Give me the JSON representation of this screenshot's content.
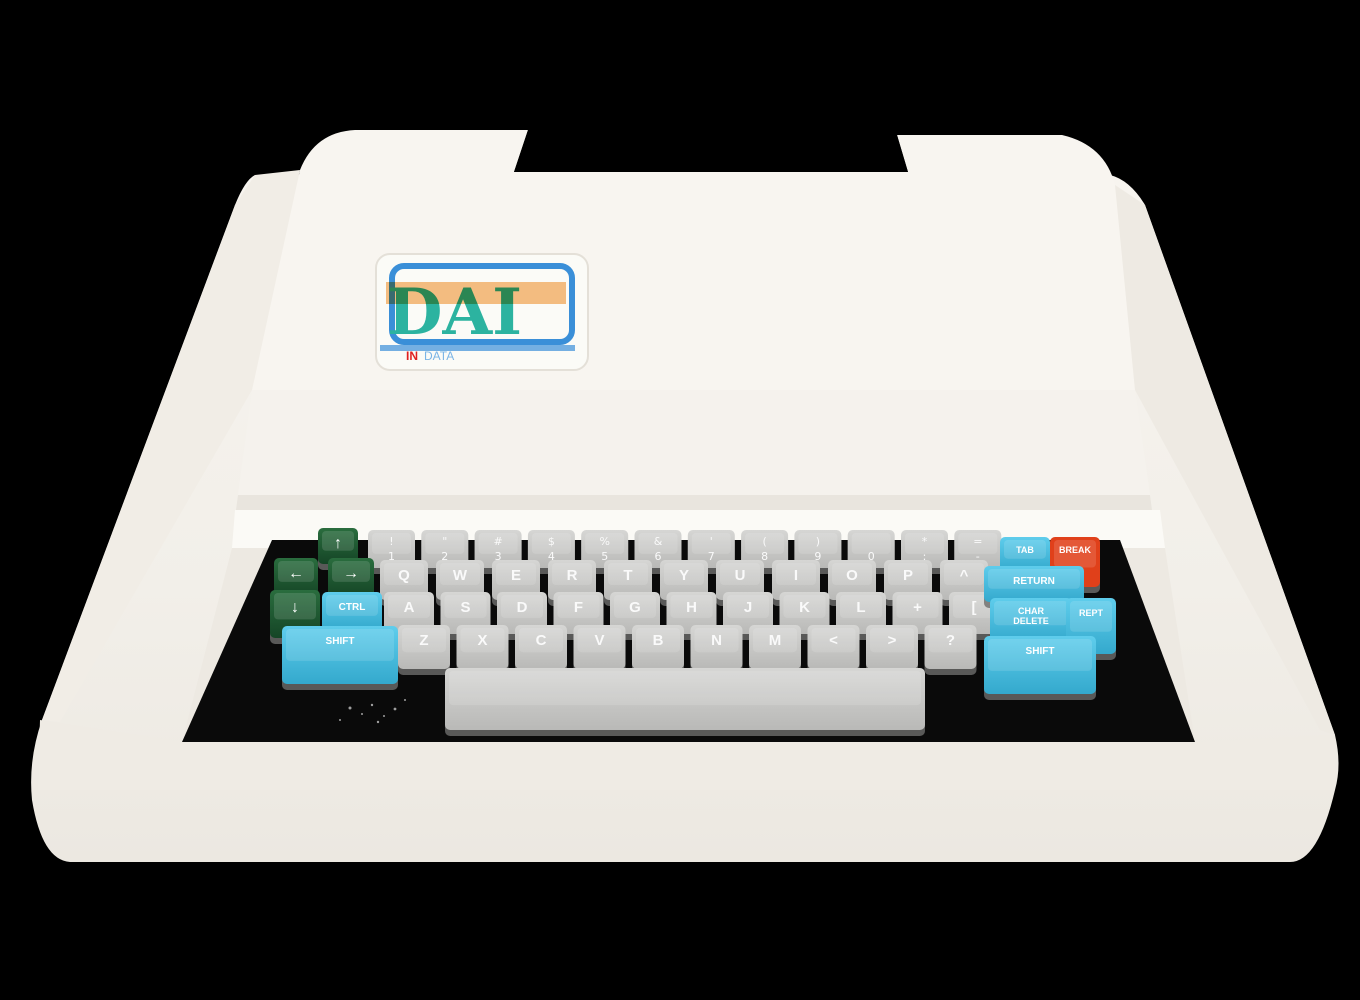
{
  "colors": {
    "background": "#000000",
    "case": "#f4f1ec",
    "key_gray": "#c9c9c7",
    "key_blue": "#4bbfe0",
    "key_green": "#1f5a32",
    "key_red": "#e0401a",
    "logo_orange": "#f08a1e",
    "logo_teal": "#2cb3a0",
    "logo_blue": "#3a8fd8",
    "logo_red": "#e02020"
  },
  "logo": {
    "brand": "DAI",
    "sub_in": "IN",
    "sub_data": "DATA"
  },
  "keys": {
    "number_row": [
      {
        "top": "!",
        "bottom": "1"
      },
      {
        "top": "\"",
        "bottom": "2"
      },
      {
        "top": "#",
        "bottom": "3"
      },
      {
        "top": "$",
        "bottom": "4"
      },
      {
        "top": "%",
        "bottom": "5"
      },
      {
        "top": "&",
        "bottom": "6"
      },
      {
        "top": "'",
        "bottom": "7"
      },
      {
        "top": "(",
        "bottom": "8"
      },
      {
        "top": ")",
        "bottom": "9"
      },
      {
        "top": "",
        "bottom": "0"
      },
      {
        "top": "*",
        "bottom": ":"
      },
      {
        "top": "=",
        "bottom": "-"
      }
    ],
    "row_q": [
      "Q",
      "W",
      "E",
      "R",
      "T",
      "Y",
      "U",
      "I",
      "O",
      "P",
      "^"
    ],
    "row_a": [
      "A",
      "S",
      "D",
      "F",
      "G",
      "H",
      "J",
      "K",
      "L",
      "+",
      "["
    ],
    "row_z": [
      "Z",
      "X",
      "C",
      "V",
      "B",
      "N",
      "M",
      "<",
      ">",
      "?"
    ],
    "special": {
      "tab": "TAB",
      "break": "BREAK",
      "return": "RETURN",
      "char_delete_1": "CHAR",
      "char_delete_2": "DELETE",
      "rept": "REPT",
      "shift_left": "SHIFT",
      "shift_right": "SHIFT",
      "ctrl": "CTRL"
    },
    "arrows": {
      "up": "↑",
      "left": "←",
      "right": "→",
      "down": "↓"
    }
  }
}
